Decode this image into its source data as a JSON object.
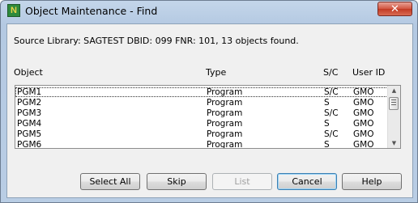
{
  "window": {
    "title": "Object Maintenance - Find",
    "icon_letter": "N",
    "close_glyph": "✕"
  },
  "status_text": "Source Library: SAGTEST  DBID: 099  FNR: 101, 13 objects found.",
  "columns": {
    "object": "Object",
    "type": "Type",
    "sc": "S/C",
    "user": "User ID"
  },
  "rows": [
    {
      "object": "PGM1",
      "type": "Program",
      "sc": "S/C",
      "user": "GMO"
    },
    {
      "object": "PGM2",
      "type": "Program",
      "sc": "S",
      "user": "GMO"
    },
    {
      "object": "PGM3",
      "type": "Program",
      "sc": "S/C",
      "user": "GMO"
    },
    {
      "object": "PGM4",
      "type": "Program",
      "sc": "S",
      "user": "GMO"
    },
    {
      "object": "PGM5",
      "type": "Program",
      "sc": "S/C",
      "user": "GMO"
    },
    {
      "object": "PGM6",
      "type": "Program",
      "sc": "S",
      "user": "GMO"
    }
  ],
  "scrollbar": {
    "up_glyph": "▲",
    "down_glyph": "▼"
  },
  "buttons": {
    "select_all": "Select All",
    "skip": "Skip",
    "list": "List",
    "cancel": "Cancel",
    "help": "Help"
  }
}
